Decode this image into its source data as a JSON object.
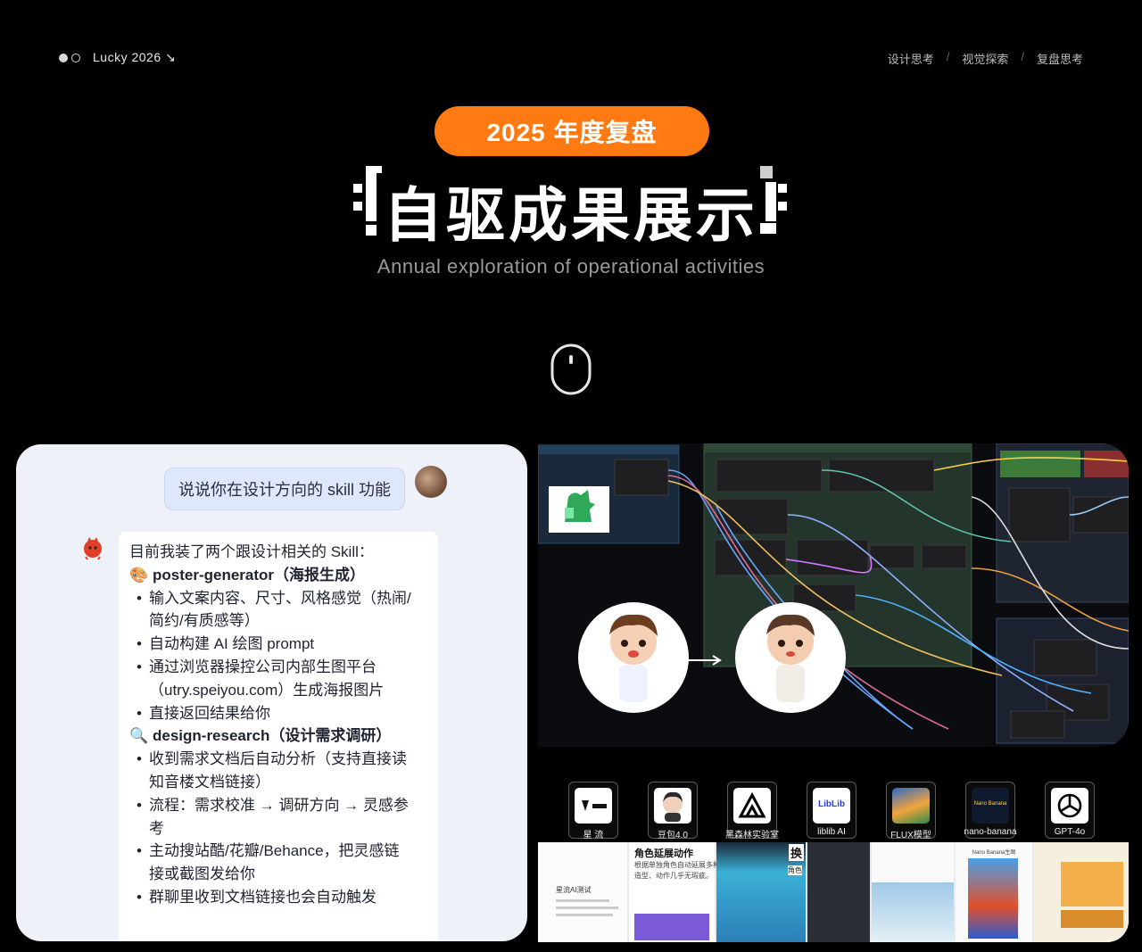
{
  "nav": {
    "brand": "Lucky 2026 ↘",
    "links": [
      "设计思考",
      "视觉探索",
      "复盘思考"
    ],
    "separator": "/"
  },
  "hero": {
    "badge": "2025 年度复盘",
    "title": "自驱成果展示",
    "subtitle": "Annual exploration of operational activities",
    "accent_color": "#ff7a12"
  },
  "chat": {
    "user_message": "说说你在设计方向的 skill 功能",
    "answer": {
      "intro": "目前我装了两个跟设计相关的 Skill：",
      "skills": [
        {
          "icon": "🎨",
          "title": "poster-generator（海报生成）",
          "bullets": [
            [
              "输入文案内容、尺寸、风格感觉（热闹/",
              "简约/有质感等）"
            ],
            [
              "自动构建 AI 绘图 prompt"
            ],
            [
              "通过浏览器操控公司内部生图平台",
              "（utry.speiyou.com）生成海报图片"
            ],
            [
              "直接返回结果给你"
            ]
          ]
        },
        {
          "icon": "🔍",
          "title": "design-research（设计需求调研）",
          "bullets": [
            [
              "收到需求文档后自动分析（支持直接读",
              "知音楼文档链接）"
            ],
            [
              "流程：需求校准 → 调研方向 → 灵感参",
              "考"
            ],
            [
              "主动搜站酷/花瓣/Behance，把灵感链",
              "接或截图发给你"
            ],
            [
              "群聊里收到文档链接也会自动触发"
            ]
          ]
        }
      ]
    }
  },
  "tools": [
    {
      "label": "星 流",
      "icon": "xingliu-icon"
    },
    {
      "label": "豆包4.0",
      "icon": "doubao-icon"
    },
    {
      "label": "黑森林实验室",
      "icon": "black-forest-labs-icon"
    },
    {
      "label": "liblib AI",
      "icon": "liblib-icon"
    },
    {
      "label": "FLUX模型",
      "icon": "flux-icon"
    },
    {
      "label": "nano-banana",
      "icon": "nano-banana-icon"
    },
    {
      "label": "GPT-4o",
      "icon": "openai-icon"
    }
  ],
  "tool_icon_text": {
    "nano": "Nano Banana",
    "liblib": "LibLib"
  },
  "docs": {
    "title": "星流AI测试",
    "heading": "角色延展动作",
    "desc": "根据单独角色自动延展多种动",
    "desc2": "造型、动作几乎无瑕疵。",
    "swap": "换",
    "swap2": "角色",
    "nano_title": "Nano Banana生图"
  }
}
